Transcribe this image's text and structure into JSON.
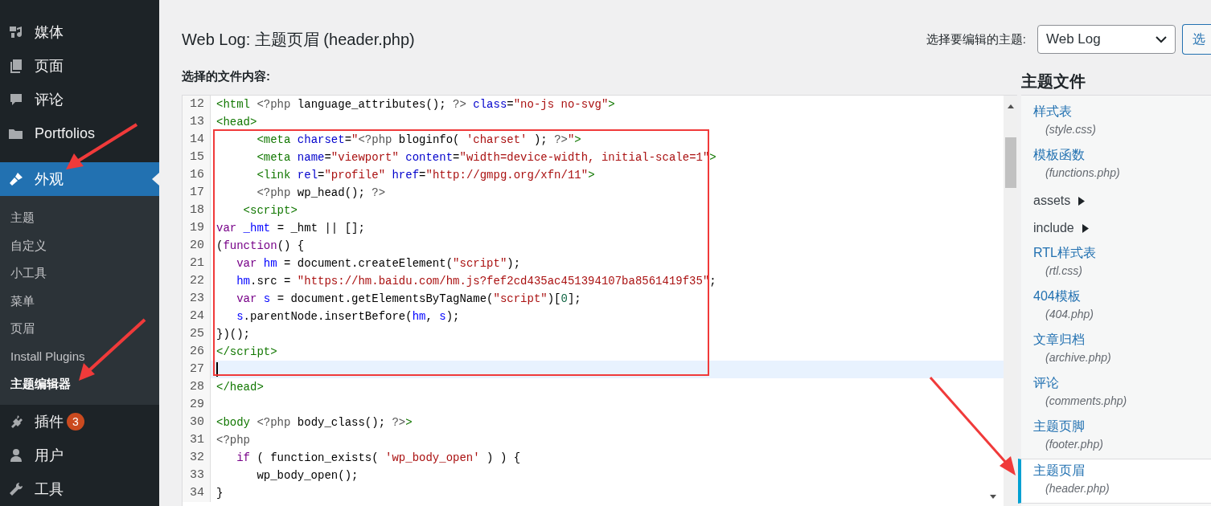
{
  "sidebar": {
    "items": [
      {
        "label": "媒体",
        "selected": false
      },
      {
        "label": "页面",
        "selected": false
      },
      {
        "label": "评论",
        "selected": false
      },
      {
        "label": "Portfolios",
        "selected": false
      },
      {
        "label": "外观",
        "selected": true,
        "expanded": true,
        "children": [
          {
            "label": "主题",
            "selected": false
          },
          {
            "label": "自定义",
            "selected": false
          },
          {
            "label": "小工具",
            "selected": false
          },
          {
            "label": "菜单",
            "selected": false
          },
          {
            "label": "页眉",
            "selected": false
          },
          {
            "label": "Install Plugins",
            "selected": false
          },
          {
            "label": "主题编辑器",
            "selected": true
          }
        ]
      },
      {
        "label": "插件",
        "selected": false,
        "badge": "3"
      },
      {
        "label": "用户",
        "selected": false
      },
      {
        "label": "工具",
        "selected": false
      }
    ]
  },
  "page_title": "Web Log: 主题页眉 (header.php)",
  "theme_picker": {
    "label": "选择要编辑的主题:",
    "value": "Web Log",
    "button": "选"
  },
  "editor": {
    "label": "选择的文件内容:",
    "lines": [
      {
        "number": "12",
        "current": false,
        "tokens": [
          {
            "kind": "tag",
            "text": "<html"
          },
          {
            "kind": "meta",
            "text": " <?php"
          },
          {
            "kind": "plain",
            "text": " language_attributes(); "
          },
          {
            "kind": "meta",
            "text": "?>"
          },
          {
            "kind": "attr",
            "text": " class"
          },
          {
            "kind": "plain",
            "text": "="
          },
          {
            "kind": "string",
            "text": "\"no-js no-svg\""
          },
          {
            "kind": "tag",
            "text": ">"
          }
        ]
      },
      {
        "number": "13",
        "current": false,
        "tokens": [
          {
            "kind": "tag",
            "text": "<head>"
          }
        ]
      },
      {
        "number": "14",
        "current": false,
        "tokens": [
          {
            "kind": "tag",
            "text": "      <meta"
          },
          {
            "kind": "attr",
            "text": " charset"
          },
          {
            "kind": "plain",
            "text": "="
          },
          {
            "kind": "string",
            "text": "\""
          },
          {
            "kind": "meta",
            "text": "<?php"
          },
          {
            "kind": "plain",
            "text": " bloginfo( "
          },
          {
            "kind": "string",
            "text": "'charset'"
          },
          {
            "kind": "plain",
            "text": " ); "
          },
          {
            "kind": "meta",
            "text": "?>"
          },
          {
            "kind": "string",
            "text": "\""
          },
          {
            "kind": "tag",
            "text": ">"
          }
        ]
      },
      {
        "number": "15",
        "current": false,
        "tokens": [
          {
            "kind": "tag",
            "text": "      <meta"
          },
          {
            "kind": "attr",
            "text": " name"
          },
          {
            "kind": "plain",
            "text": "="
          },
          {
            "kind": "string",
            "text": "\"viewport\""
          },
          {
            "kind": "attr",
            "text": " content"
          },
          {
            "kind": "plain",
            "text": "="
          },
          {
            "kind": "string",
            "text": "\"width=device-width, initial-scale=1\""
          },
          {
            "kind": "tag",
            "text": ">"
          }
        ]
      },
      {
        "number": "16",
        "current": false,
        "tokens": [
          {
            "kind": "tag",
            "text": "      <link"
          },
          {
            "kind": "attr",
            "text": " rel"
          },
          {
            "kind": "plain",
            "text": "="
          },
          {
            "kind": "string",
            "text": "\"profile\""
          },
          {
            "kind": "attr",
            "text": " href"
          },
          {
            "kind": "plain",
            "text": "="
          },
          {
            "kind": "string",
            "text": "\"http://gmpg.org/xfn/11\""
          },
          {
            "kind": "tag",
            "text": ">"
          }
        ]
      },
      {
        "number": "17",
        "current": false,
        "tokens": [
          {
            "kind": "meta",
            "text": "      <?php"
          },
          {
            "kind": "plain",
            "text": " wp_head(); "
          },
          {
            "kind": "meta",
            "text": "?>"
          }
        ]
      },
      {
        "number": "18",
        "current": false,
        "tokens": [
          {
            "kind": "tag",
            "text": "    <script>"
          }
        ]
      },
      {
        "number": "19",
        "current": false,
        "tokens": [
          {
            "kind": "keyword",
            "text": "var"
          },
          {
            "kind": "def",
            "text": " _hmt"
          },
          {
            "kind": "plain",
            "text": " = _hmt || [];"
          }
        ]
      },
      {
        "number": "20",
        "current": false,
        "tokens": [
          {
            "kind": "plain",
            "text": "("
          },
          {
            "kind": "keyword",
            "text": "function"
          },
          {
            "kind": "plain",
            "text": "() {"
          }
        ]
      },
      {
        "number": "21",
        "current": false,
        "tokens": [
          {
            "kind": "keyword",
            "text": "   var"
          },
          {
            "kind": "def",
            "text": " hm"
          },
          {
            "kind": "plain",
            "text": " = document.createElement("
          },
          {
            "kind": "string",
            "text": "\"script\""
          },
          {
            "kind": "plain",
            "text": ");"
          }
        ]
      },
      {
        "number": "22",
        "current": false,
        "tokens": [
          {
            "kind": "def",
            "text": "   hm"
          },
          {
            "kind": "plain",
            "text": ".src = "
          },
          {
            "kind": "string",
            "text": "\"https://hm.baidu.com/hm.js?fef2cd435ac451394107ba8561419f35\""
          },
          {
            "kind": "plain",
            "text": ";"
          }
        ]
      },
      {
        "number": "23",
        "current": false,
        "tokens": [
          {
            "kind": "keyword",
            "text": "   var"
          },
          {
            "kind": "def",
            "text": " s"
          },
          {
            "kind": "plain",
            "text": " = document.getElementsByTagName("
          },
          {
            "kind": "string",
            "text": "\"script\""
          },
          {
            "kind": "plain",
            "text": ")["
          },
          {
            "kind": "number",
            "text": "0"
          },
          {
            "kind": "plain",
            "text": "];"
          }
        ]
      },
      {
        "number": "24",
        "current": false,
        "tokens": [
          {
            "kind": "def",
            "text": "   s"
          },
          {
            "kind": "plain",
            "text": ".parentNode.insertBefore("
          },
          {
            "kind": "def",
            "text": "hm"
          },
          {
            "kind": "plain",
            "text": ", "
          },
          {
            "kind": "def",
            "text": "s"
          },
          {
            "kind": "plain",
            "text": ");"
          }
        ]
      },
      {
        "number": "25",
        "current": false,
        "tokens": [
          {
            "kind": "plain",
            "text": "})();"
          }
        ]
      },
      {
        "number": "26",
        "current": false,
        "tokens": [
          {
            "kind": "tag",
            "text": "</script>"
          }
        ]
      },
      {
        "number": "27",
        "current": true
      },
      {
        "number": "28",
        "current": false,
        "tokens": [
          {
            "kind": "tag",
            "text": "</head>"
          }
        ]
      },
      {
        "number": "29",
        "current": false
      },
      {
        "number": "30",
        "current": false,
        "tokens": [
          {
            "kind": "tag",
            "text": "<body"
          },
          {
            "kind": "meta",
            "text": " <?php"
          },
          {
            "kind": "plain",
            "text": " body_class(); "
          },
          {
            "kind": "meta",
            "text": "?>"
          },
          {
            "kind": "tag",
            "text": ">"
          }
        ]
      },
      {
        "number": "31",
        "current": false,
        "tokens": [
          {
            "kind": "meta",
            "text": "<?php"
          }
        ]
      },
      {
        "number": "32",
        "current": false,
        "tokens": [
          {
            "kind": "keyword",
            "text": "   if"
          },
          {
            "kind": "plain",
            "text": " ( function_exists( "
          },
          {
            "kind": "string",
            "text": "'wp_body_open'"
          },
          {
            "kind": "plain",
            "text": " ) ) {"
          }
        ]
      },
      {
        "number": "33",
        "current": false,
        "tokens": [
          {
            "kind": "plain",
            "text": "      wp_body_open();"
          }
        ]
      },
      {
        "number": "34",
        "current": false,
        "tokens": [
          {
            "kind": "plain",
            "text": "}"
          }
        ]
      }
    ]
  },
  "theme_files": {
    "title": "主题文件",
    "items": [
      {
        "kind": "file",
        "label": "样式表",
        "file": "(style.css)",
        "selected": false
      },
      {
        "kind": "file",
        "label": "模板函数",
        "file": "(functions.php)",
        "selected": false
      },
      {
        "kind": "folder",
        "label": "assets"
      },
      {
        "kind": "folder",
        "label": "include"
      },
      {
        "kind": "file",
        "label": "RTL样式表",
        "file": "(rtl.css)",
        "selected": false
      },
      {
        "kind": "file",
        "label": "404模板",
        "file": "(404.php)",
        "selected": false
      },
      {
        "kind": "file",
        "label": "文章归档",
        "file": "(archive.php)",
        "selected": false
      },
      {
        "kind": "file",
        "label": "评论",
        "file": "(comments.php)",
        "selected": false
      },
      {
        "kind": "file",
        "label": "主题页脚",
        "file": "(footer.php)",
        "selected": false
      },
      {
        "kind": "file",
        "label": "主题页眉",
        "file": "(header.php)",
        "selected": true
      }
    ]
  }
}
